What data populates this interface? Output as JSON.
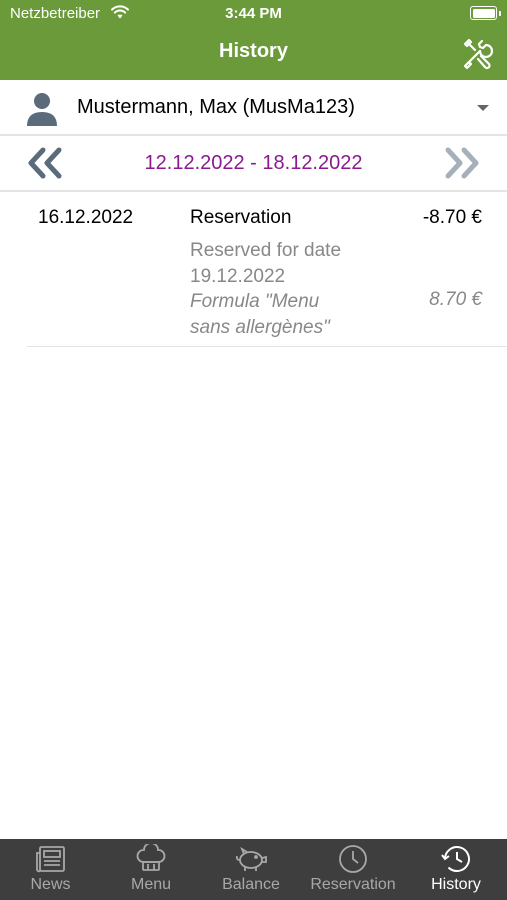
{
  "status_bar": {
    "carrier": "Netzbetreiber",
    "time": "3:44 PM"
  },
  "header": {
    "title": "History",
    "settings_icon": "tools-icon"
  },
  "user": {
    "name": "Mustermann, Max (MusMa123)",
    "icon": "person-icon"
  },
  "week": {
    "range": "12.12.2022 - 18.12.2022",
    "range_color": "#8a1a8f"
  },
  "entries": [
    {
      "date": "16.12.2022",
      "type": "Reservation",
      "amount": "-8.70 €",
      "reserved_line1": "Reserved for date",
      "reserved_line2": "19.12.2022",
      "formula_line1": "Formula \"Menu",
      "formula_line2": "sans allergènes\"",
      "formula_price": "8.70 €"
    }
  ],
  "tabs": [
    {
      "label": "News",
      "icon": "newspaper-icon"
    },
    {
      "label": "Menu",
      "icon": "chef-hat-icon"
    },
    {
      "label": "Balance",
      "icon": "piggy-bank-icon"
    },
    {
      "label": "Reservation",
      "icon": "clock-icon"
    },
    {
      "label": "History",
      "icon": "history-icon",
      "active": true
    }
  ],
  "colors": {
    "header": "#6a9a3a",
    "tabbar": "#3e3e3e"
  }
}
